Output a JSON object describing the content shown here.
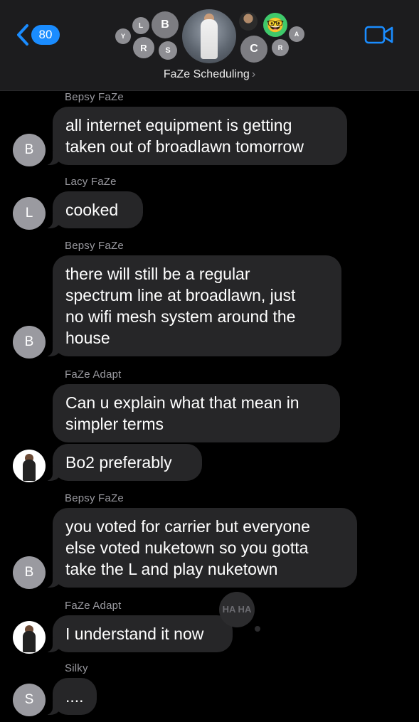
{
  "header": {
    "back_count": "80",
    "group_name": "FaZe Scheduling",
    "chevron": "›",
    "participant_initials": [
      "Y",
      "L",
      "B",
      "R",
      "S",
      "C",
      "R",
      "A"
    ],
    "emoji_avatar": "🤓",
    "back_icon": "chevron-left-icon",
    "video_icon": "video-camera-icon",
    "accent_color": "#1a8cff"
  },
  "messages": [
    {
      "sender": "Bepsy FaZe",
      "avatar": "B",
      "text_lines": [
        "all internet equipment is getting",
        "taken out of broadlawn tomorrow"
      ]
    },
    {
      "sender": "Lacy FaZe",
      "avatar": "L",
      "text_lines": [
        "cooked"
      ]
    },
    {
      "sender": "Bepsy FaZe",
      "avatar": "B",
      "text_lines": [
        "there will still be a regular",
        "spectrum line at broadlawn, just",
        "no wifi mesh system around the",
        "house"
      ]
    },
    {
      "sender": "FaZe Adapt",
      "avatar": "photo",
      "text_lines": [
        "Can u explain what that mean in",
        "simpler terms"
      ]
    },
    {
      "sender": "",
      "avatar": "photo",
      "text_lines": [
        "Bo2 preferably"
      ]
    },
    {
      "sender": "Bepsy FaZe",
      "avatar": "B",
      "text_lines": [
        "you voted for carrier but everyone",
        "else voted nuketown so you gotta",
        "take the L and play nuketown"
      ]
    },
    {
      "sender": "FaZe Adapt",
      "avatar": "photo",
      "text_lines": [
        "I understand it now"
      ],
      "tapback": "HA HA"
    },
    {
      "sender": "Silky",
      "avatar": "S",
      "text_lines": [
        "...."
      ]
    }
  ]
}
